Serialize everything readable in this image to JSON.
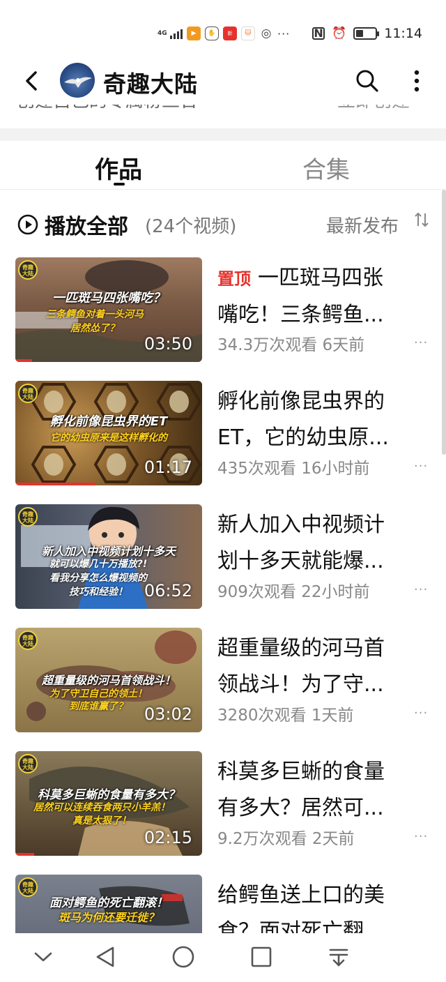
{
  "status_bar": {
    "network": "4G",
    "time": "11:14",
    "app_icons": [
      {
        "name": "play-app-icon",
        "color": "#f29a1f"
      },
      {
        "name": "hand-icon",
        "color": "#555555"
      },
      {
        "name": "news-app-icon",
        "color": "#e5322d"
      },
      {
        "name": "cat-app-icon",
        "color": "#f07020"
      },
      {
        "name": "globe-icon",
        "color": "#555555"
      }
    ],
    "more": "···"
  },
  "header": {
    "channel_name": "奇趣大陆",
    "peek_left": "创建自己的专属粉丝合",
    "peek_right": "立即创建"
  },
  "tabs": [
    {
      "label": "作品",
      "active": true
    },
    {
      "label": "合集",
      "active": false
    }
  ],
  "play_all": {
    "label": "播放全部",
    "count": "(24个视频)",
    "sort": "最新发布"
  },
  "videos": [
    {
      "pin": "置顶",
      "title_line1": "一匹斑马四张",
      "title_line2": "嘴吃！三条鳄鱼...",
      "meta": "34.3万次观看 6天前",
      "duration": "03:50",
      "caption1": "一匹斑马四张嘴吃？",
      "caption2": "三条鳄鱼对着一头河马 居然怂了？",
      "progress": 0.09,
      "bg": "#8a6a55"
    },
    {
      "pin": "",
      "title_line1": "孵化前像昆虫界的",
      "title_line2": "ET，它的幼虫原...",
      "meta": "435次观看 16小时前",
      "duration": "01:17",
      "caption1": "孵化前像昆虫界的ET",
      "caption2": "它的幼虫原来是这样孵化的",
      "progress": 0.43,
      "bg": "#6b4a22"
    },
    {
      "pin": "",
      "title_line1": "新人加入中视频计",
      "title_line2": "划十多天就能爆...",
      "meta": "909次观看 22小时前",
      "duration": "06:52",
      "caption1": "新人加入中视频计划十多天",
      "caption2": "就可以爆几十万播放?! 看我分享怎么爆视频的 技巧和经验！",
      "progress": 0,
      "bg": "#4a5568"
    },
    {
      "pin": "",
      "title_line1": "超重量级的河马首",
      "title_line2": "领战斗！为了守...",
      "meta": "3280次观看 1天前",
      "duration": "03:02",
      "caption1": "超重量级的河马首领战斗！",
      "caption2": "为了守卫自己的领土！ 到底谁赢了？",
      "progress": 0,
      "bg": "#a08a55"
    },
    {
      "pin": "",
      "title_line1": "科莫多巨蜥的食量",
      "title_line2": "有多大？居然可...",
      "meta": "9.2万次观看 2天前",
      "duration": "02:15",
      "caption1": "科莫多巨蜥的食量有多大？",
      "caption2": "居然可以连续吞食两只小羊羔！ 真是太狠了！",
      "progress": 0.1,
      "bg": "#7a6a4a"
    },
    {
      "pin": "",
      "title_line1": "给鳄鱼送上口的美",
      "title_line2": "食？面对死亡翻",
      "meta": "",
      "duration": "",
      "caption1": "面对鳄鱼的死亡翻滚！",
      "caption2": "斑马为何还要迁徙？",
      "progress": 0,
      "bg": "#6a7080"
    }
  ],
  "nav_bar": [
    "chevron-down-icon",
    "back-triangle-icon",
    "home-circle-icon",
    "recents-square-icon",
    "menu-down-icon"
  ]
}
